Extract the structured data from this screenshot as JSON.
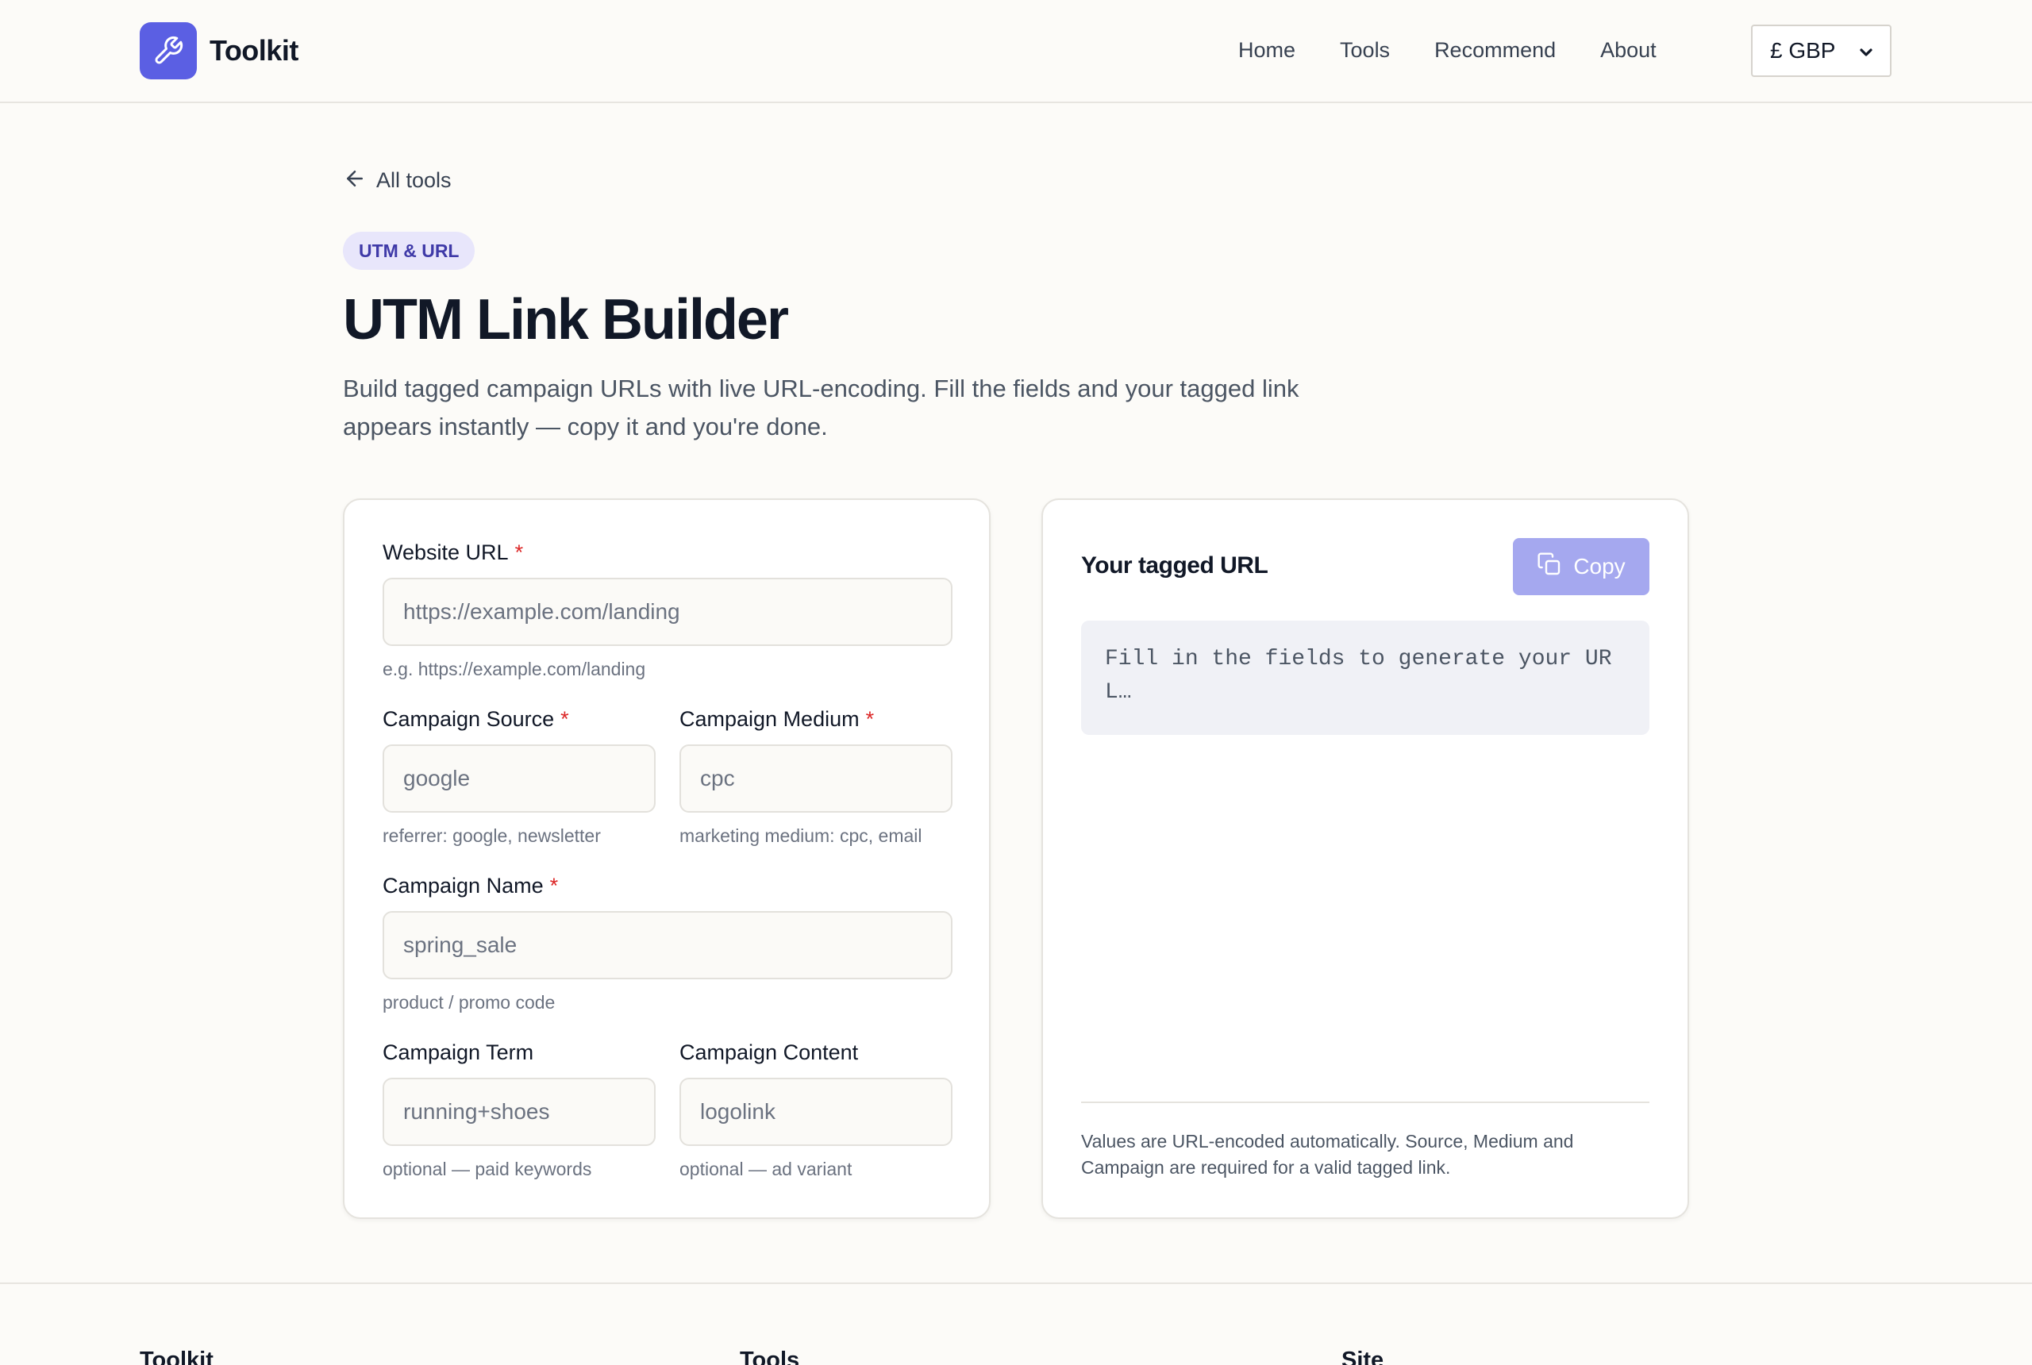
{
  "header": {
    "brand": "Toolkit",
    "nav": [
      "Home",
      "Tools",
      "Recommend",
      "About"
    ],
    "currency": "£ GBP"
  },
  "back_link": "All tools",
  "tag": "UTM & URL",
  "title": "UTM Link Builder",
  "description": "Build tagged campaign URLs with live URL-encoding. Fill the fields and your tagged link appears instantly — copy it and you're done.",
  "form": {
    "website_url": {
      "label": "Website URL",
      "required": "*",
      "placeholder": "https://example.com/landing",
      "hint": "e.g. https://example.com/landing"
    },
    "source": {
      "label": "Campaign Source",
      "required": "*",
      "placeholder": "google",
      "hint": "referrer: google, newsletter"
    },
    "medium": {
      "label": "Campaign Medium",
      "required": "*",
      "placeholder": "cpc",
      "hint": "marketing medium: cpc, email"
    },
    "name": {
      "label": "Campaign Name",
      "required": "*",
      "placeholder": "spring_sale",
      "hint": "product / promo code"
    },
    "term": {
      "label": "Campaign Term",
      "placeholder": "running+shoes",
      "hint": "optional — paid keywords"
    },
    "content": {
      "label": "Campaign Content",
      "placeholder": "logolink",
      "hint": "optional — ad variant"
    }
  },
  "output": {
    "title": "Your tagged URL",
    "copy_label": "Copy",
    "placeholder_text": "Fill in the fields to generate your UR L…",
    "note": "Values are URL-encoded automatically. Source, Medium and Campaign are required for a valid tagged link."
  },
  "footer": {
    "columns": [
      "Toolkit",
      "Tools",
      "Site"
    ]
  },
  "colors": {
    "accent": "#5b5fe3",
    "copy_button": "#a5a8ef",
    "tag_bg": "#e8e6fb",
    "required": "#dc2626"
  }
}
